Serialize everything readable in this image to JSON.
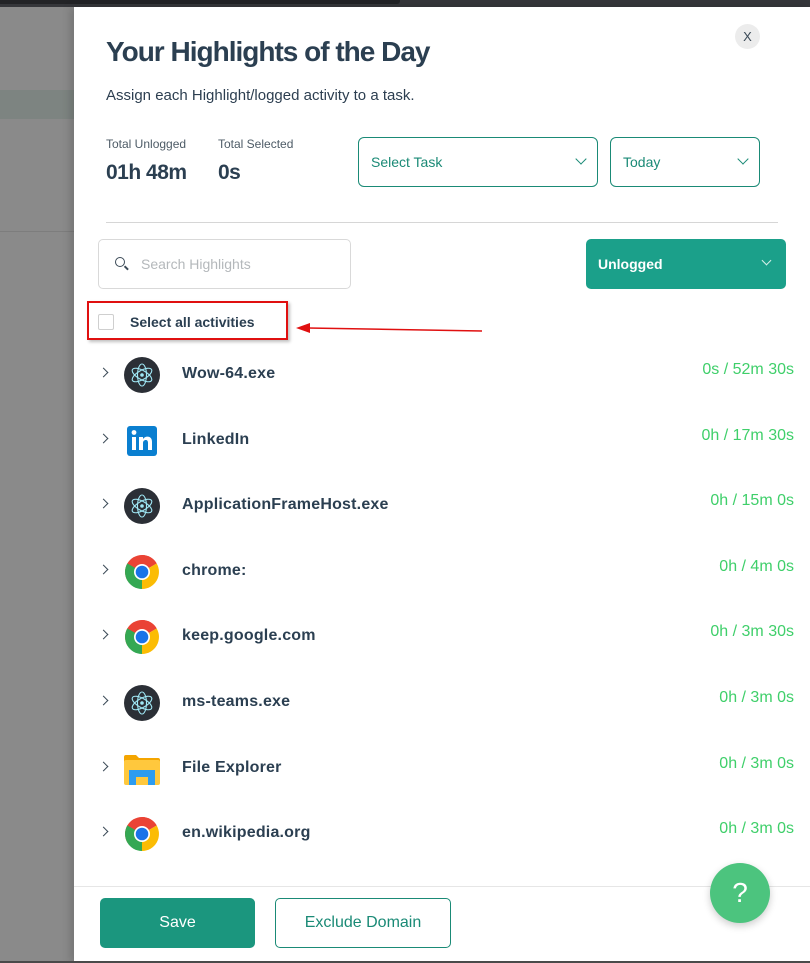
{
  "header": {
    "title": "Your Highlights of the Day",
    "subtitle": "Assign each Highlight/logged activity to a task.",
    "close_label": "X"
  },
  "stats": {
    "unlogged_label": "Total Unlogged",
    "unlogged_value": "01h 48m",
    "selected_label": "Total Selected",
    "selected_value": "0s"
  },
  "selects": {
    "task": "Select Task",
    "date": "Today"
  },
  "search": {
    "placeholder": "Search Highlights",
    "value": ""
  },
  "filter": {
    "selected": "Unlogged"
  },
  "select_all": {
    "label": "Select all activities",
    "checked": false
  },
  "activities": [
    {
      "name": "Wow-64.exe",
      "time": "0s / 52m 30s",
      "icon": "electron-app-icon"
    },
    {
      "name": "LinkedIn",
      "time": "0h / 17m 30s",
      "icon": "linkedin-icon"
    },
    {
      "name": "ApplicationFrameHost.exe",
      "time": "0h / 15m 0s",
      "icon": "electron-app-icon"
    },
    {
      "name": "chrome:",
      "time": "0h / 4m 0s",
      "icon": "chrome-icon"
    },
    {
      "name": "keep.google.com",
      "time": "0h / 3m 30s",
      "icon": "chrome-icon"
    },
    {
      "name": "ms-teams.exe",
      "time": "0h / 3m 0s",
      "icon": "electron-app-icon"
    },
    {
      "name": "File Explorer",
      "time": "0h / 3m 0s",
      "icon": "file-explorer-icon"
    },
    {
      "name": "en.wikipedia.org",
      "time": "0h / 3m 0s",
      "icon": "chrome-icon"
    }
  ],
  "footer": {
    "save_label": "Save",
    "exclude_label": "Exclude Domain"
  },
  "help": {
    "label": "?"
  },
  "colors": {
    "primary": "#1b967e",
    "accent_green": "#3fcf6a",
    "heading": "#2b3f51",
    "annotation": "#e01010"
  }
}
